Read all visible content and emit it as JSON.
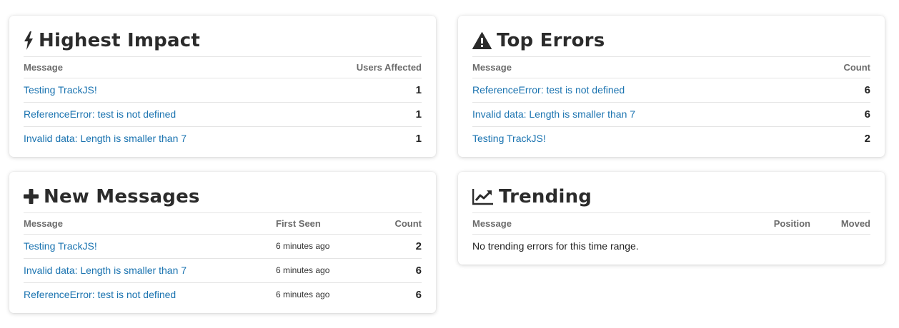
{
  "highest_impact": {
    "title": "Highest Impact",
    "icon": "bolt-icon",
    "col_message": "Message",
    "col_users": "Users Affected",
    "rows": [
      {
        "message": "Testing TrackJS!",
        "users": "1"
      },
      {
        "message": "ReferenceError: test is not defined",
        "users": "1"
      },
      {
        "message": "Invalid data: Length is smaller than 7",
        "users": "1"
      }
    ]
  },
  "top_errors": {
    "title": "Top Errors",
    "icon": "warning-icon",
    "col_message": "Message",
    "col_count": "Count",
    "rows": [
      {
        "message": "ReferenceError: test is not defined",
        "count": "6"
      },
      {
        "message": "Invalid data: Length is smaller than 7",
        "count": "6"
      },
      {
        "message": "Testing TrackJS!",
        "count": "2"
      }
    ]
  },
  "new_messages": {
    "title": "New Messages",
    "icon": "plus-icon",
    "col_message": "Message",
    "col_first_seen": "First Seen",
    "col_count": "Count",
    "rows": [
      {
        "message": "Testing TrackJS!",
        "first_seen": "6 minutes ago",
        "count": "2"
      },
      {
        "message": "Invalid data: Length is smaller than 7",
        "first_seen": "6 minutes ago",
        "count": "6"
      },
      {
        "message": "ReferenceError: test is not defined",
        "first_seen": "6 minutes ago",
        "count": "6"
      }
    ]
  },
  "trending": {
    "title": "Trending",
    "icon": "line-chart-icon",
    "col_message": "Message",
    "col_position": "Position",
    "col_moved": "Moved",
    "empty_text": "No trending errors for this time range."
  },
  "colors": {
    "link": "#1a73b0",
    "title": "#2b2b2b",
    "header": "#6b6b6b"
  }
}
